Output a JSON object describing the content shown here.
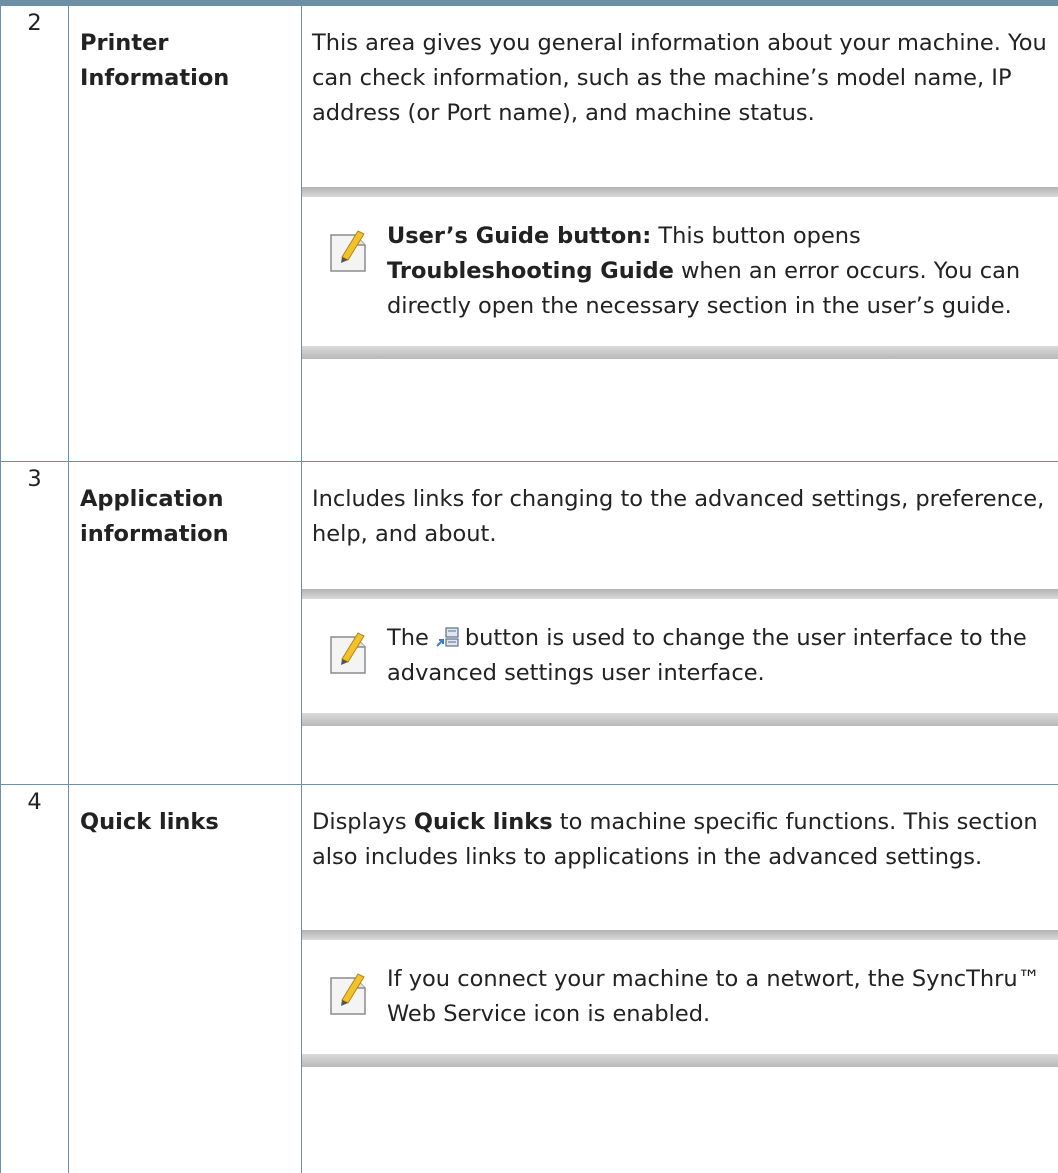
{
  "rows": [
    {
      "number": "2",
      "name_line1": "Printer",
      "name_line2": "Information",
      "description": "This area gives you general information about your machine. You can check information, such as the machine’s model name, IP address (or Port name), and machine status.",
      "note": {
        "bold_lead": "User’s Guide button:",
        "text1": " This button opens ",
        "bold_mid": "Troubleshooting Guide",
        "text2": " when an error occurs. You can directly open the necessary section in the user’s guide."
      }
    },
    {
      "number": "3",
      "name_line1": "Application",
      "name_line2": "information",
      "description": "Includes links for changing to the advanced settings, preference, help, and about.",
      "note": {
        "text_before_icon": "The",
        "icon": "switch-ui-icon",
        "text_after_icon": "button is used to change the user interface to the advanced settings user interface."
      }
    },
    {
      "number": "4",
      "name_line1": "Quick links",
      "description_before": "Displays ",
      "description_bold": "Quick links",
      "description_after": " to machine specific functions. This section also includes links to applications in the advanced settings.",
      "note": {
        "text": "If you connect your machine to a networt, the SyncThru™ Web Service icon is enabled."
      }
    }
  ],
  "colors": {
    "rule": "#6f8fa6",
    "note_bar": "#c4c4c4"
  }
}
